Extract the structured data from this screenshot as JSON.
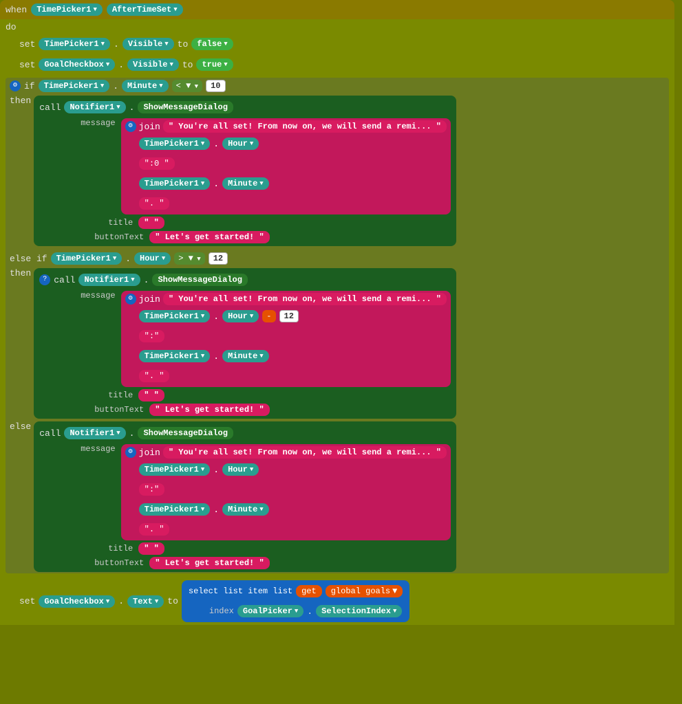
{
  "when": {
    "label": "when",
    "component": "TimePicker1",
    "event": "AfterTimeSet"
  },
  "do": {
    "set1": {
      "label": "set",
      "component": "TimePicker1",
      "property": "Visible",
      "op": "to",
      "value": "false"
    },
    "set2": {
      "label": "set",
      "component": "GoalCheckbox",
      "property": "Visible",
      "op": "to",
      "value": "true"
    },
    "if_label": "if",
    "condition1": {
      "component": "TimePicker1",
      "property": "Minute",
      "op": "<",
      "value": "10"
    },
    "then_label": "then",
    "call1": {
      "label": "call",
      "component": "Notifier1",
      "method": "ShowMessageDialog"
    },
    "message_label": "message",
    "join_label": "join",
    "msg1_text": "\" You're all set! From now on, we will send a remi... \"",
    "tp1_hour": "TimePicker1",
    "hour_label": "Hour",
    "colon0": "\":0 \"",
    "tp1_minute": "TimePicker1",
    "minute_label": "Minute",
    "dot1": "\". \"",
    "title_label": "title",
    "title_val": "\" \"",
    "buttonText_label": "buttonText",
    "btn_val1": "\" Let's get started! \"",
    "elseif_label": "else if",
    "condition2": {
      "component": "TimePicker1",
      "property": "Hour",
      "op": ">",
      "value": "12"
    },
    "then2_label": "then",
    "call2_label": "call",
    "msg2_text": "\" You're all set! From now on, we will send a remi... \"",
    "tp2_hour": "TimePicker1",
    "hour2_label": "Hour",
    "minus_label": "-",
    "value12": "12",
    "colon1": "\":\"",
    "tp2_minute": "TimePicker1",
    "minute2_label": "Minute",
    "dot2": "\". \"",
    "title2_val": "\" \"",
    "btn_val2": "\" Let's get started! \"",
    "else_label": "else",
    "call3_label": "call",
    "msg3_text": "\" You're all set! From now on, we will send a remi... \"",
    "tp3_hour": "TimePicker1",
    "hour3_label": "Hour",
    "colon2": "\":\"",
    "tp3_minute": "TimePicker1",
    "minute3_label": "Minute",
    "dot3": "\". \"",
    "title3_val": "\" \"",
    "btn_val3": "\" Let's get started! \"",
    "set3": {
      "label": "set",
      "component": "GoalCheckbox",
      "property": "Text",
      "op": "to"
    },
    "select_list": "select list item  list",
    "get_label": "get",
    "global_goals": "global goals",
    "index_label": "index",
    "goal_picker": "GoalPicker",
    "selection_index": "SelectionIndex"
  }
}
